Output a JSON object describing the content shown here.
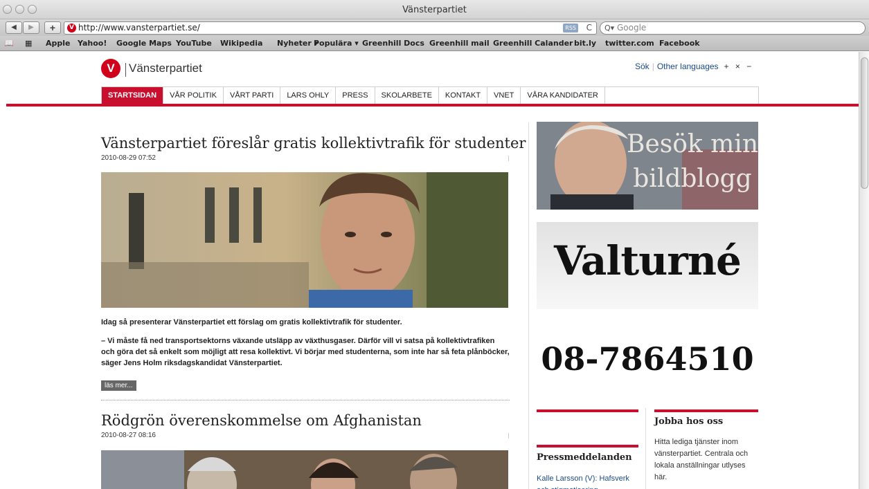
{
  "window": {
    "title": "Vänsterpartiet"
  },
  "toolbar": {
    "back": "◀",
    "forward": "▶",
    "add": "+",
    "url": "http://www.vansterpartiet.se/",
    "rss": "RSS",
    "reload": "C",
    "search_placeholder": "Google",
    "search_prefix": "Q▾"
  },
  "bookmarks": [
    "Apple",
    "Yahoo!",
    "Google Maps",
    "YouTube",
    "Wikipedia",
    "Nyheter ▾",
    "Populära ▾",
    "Greenhill Docs",
    "Greenhill mail",
    "Greenhill Calander",
    "bit.ly",
    "twitter.com",
    "Facebook"
  ],
  "site": {
    "logo_letter": "V",
    "logo_text": "Vänsterpartiet",
    "top_links": {
      "search": "Sök",
      "languages": "Other languages",
      "sizes": "+ × −"
    },
    "nav": [
      "STARTSIDAN",
      "VÅR POLITIK",
      "VÅRT PARTI",
      "LARS OHLY",
      "PRESS",
      "SKOLARBETE",
      "KONTAKT",
      "VNET",
      "VÅRA KANDIDATER"
    ]
  },
  "articles": [
    {
      "title": "Vänsterpartiet föreslår gratis kollektivtrafik för studenter",
      "date": "2010-08-29 07:52",
      "intro": "Idag så presenterar Vänsterpartiet ett förslag om gratis kollektivtrafik för studenter.",
      "quote": "– Vi måste få ned transportsektorns växande utsläpp av växthusgaser. Därför vill vi satsa på kollektivtrafiken och göra det så enkelt som möjligt att resa kollektivt. Vi börjar med studenterna, som inte har så feta plånböcker, säger Jens Holm riksdagskandidat Vänsterpartiet.",
      "read_more": "läs mer..."
    },
    {
      "title": "Rödgrön överenskommelse om Afghanistan",
      "date": "2010-08-27 08:16"
    }
  ],
  "sidebar": {
    "blog_banner": {
      "line1": "Besök min",
      "line2": "bildblogg"
    },
    "valturne": "Valturné",
    "phone": "08-7864510",
    "press": {
      "title": "Pressmeddelanden",
      "item": "Kalle Larsson (V): Hafsverk och stigmatisering"
    },
    "jobs": {
      "title": "Jobba hos oss",
      "text": "Hitta lediga tjänster inom vänsterpartiet. Centrala och lokala anställningar utlyses här."
    }
  }
}
